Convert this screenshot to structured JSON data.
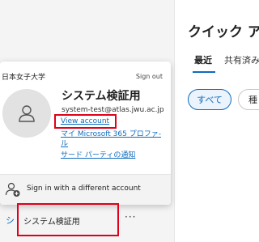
{
  "page": {
    "title": "クイック ア",
    "tabs": [
      {
        "label": "最近"
      },
      {
        "label": "共有済み"
      }
    ],
    "filters": [
      {
        "label": "すべて"
      },
      {
        "label": "種"
      }
    ]
  },
  "account_card": {
    "org_name": "日本女子大学",
    "sign_out": "Sign out",
    "display_name": "システム検証用",
    "email": "system-test@atlas.jwu.ac.jp",
    "links": {
      "view_account": "View account",
      "my_ms365_line1": "マイ Microsoft 365 プロファ-",
      "my_ms365_line2": "ル",
      "third_party": "サード パーティの通知"
    },
    "sign_in_different": "Sign in with a different account"
  },
  "nav": {
    "prefix": "シ",
    "label": "システム検証用",
    "more": "···"
  },
  "colors": {
    "accent": "#0f6cbd",
    "highlight": "#e0001a"
  }
}
